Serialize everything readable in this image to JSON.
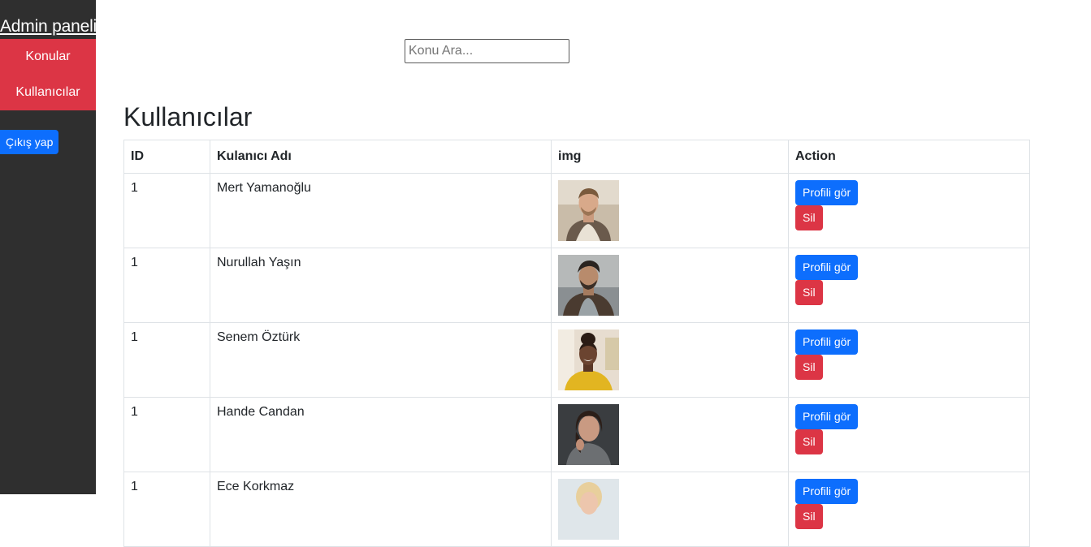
{
  "sidebar": {
    "brand": "Admin paneli",
    "items": [
      {
        "label": "Konular"
      },
      {
        "label": "Kullanıcılar"
      }
    ],
    "logout_label": "Çıkış yap"
  },
  "search": {
    "placeholder": "Konu Ara..."
  },
  "main": {
    "title": "Kullanıcılar",
    "table": {
      "headers": [
        "ID",
        "Kulanıcı Adı",
        "img",
        "Action"
      ],
      "rows": [
        {
          "id": "1",
          "name": "Mert Yamanoğlu",
          "avatar": "avatar-man-beige-coat"
        },
        {
          "id": "1",
          "name": "Nurullah Yaşın",
          "avatar": "avatar-man-leather-jacket"
        },
        {
          "id": "1",
          "name": "Senem Öztürk",
          "avatar": "avatar-woman-yellow-top"
        },
        {
          "id": "1",
          "name": "Hande Candan",
          "avatar": "avatar-woman-grey-sweater"
        },
        {
          "id": "1",
          "name": "Ece Korkmaz",
          "avatar": "avatar-woman-blonde"
        }
      ],
      "view_label": "Profili gör",
      "delete_label": "Sil"
    }
  },
  "colors": {
    "sidebar_bg": "#2f2f2f",
    "nav_bg": "#dc3545",
    "primary": "#0d6efd",
    "danger": "#dc3545"
  }
}
